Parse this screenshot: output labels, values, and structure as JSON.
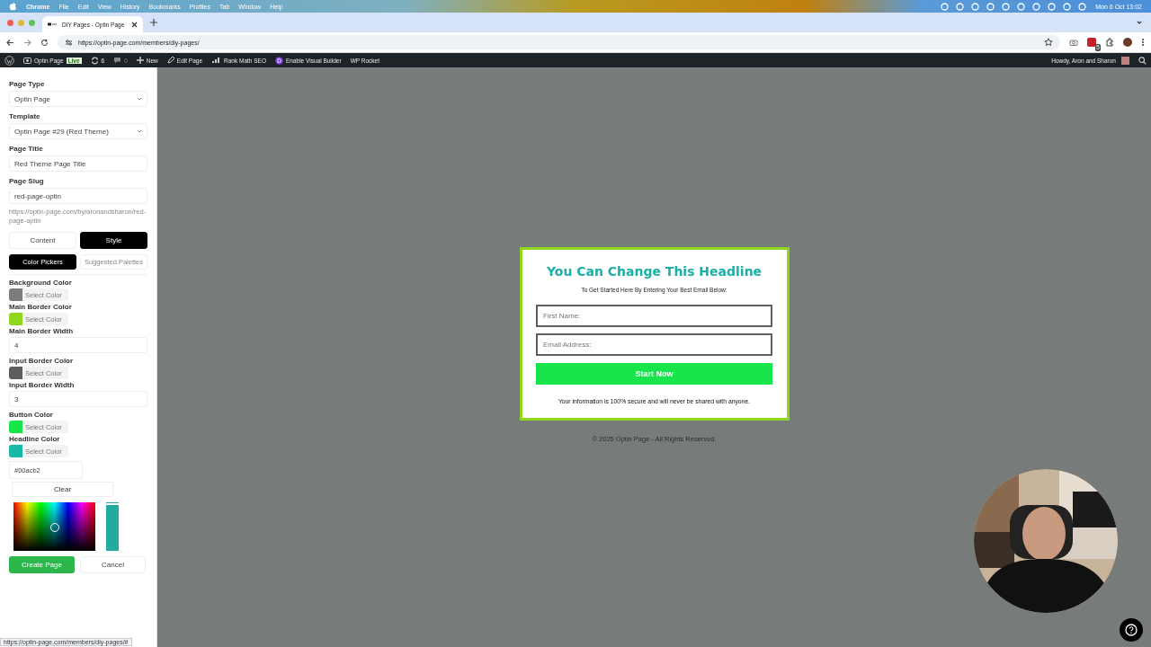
{
  "menubar": {
    "app": "Chrome",
    "menus": [
      "File",
      "Edit",
      "View",
      "History",
      "Bookmarks",
      "Profiles",
      "Tab",
      "Window",
      "Help"
    ],
    "clock": "Mon 6 Oct  13:02"
  },
  "browser": {
    "tab_title": "DIY Pages - Optin Page",
    "url": "https://optin-page.com/members/diy-pages/",
    "extension_badge": "5"
  },
  "admin_bar": {
    "items": [
      {
        "kind": "site",
        "label": "Optin Page",
        "badge": "Live"
      },
      {
        "kind": "updates",
        "label": "6"
      },
      {
        "kind": "comments",
        "label": "0"
      },
      {
        "kind": "new",
        "label": "New"
      },
      {
        "kind": "edit",
        "label": "Edit Page"
      },
      {
        "kind": "seo",
        "label": "Rank Math SEO"
      },
      {
        "kind": "builder",
        "label": "Enable Visual Builder"
      },
      {
        "kind": "plain",
        "label": "WP Rocket"
      }
    ],
    "greeting": "Howdy, Aron and Sharon"
  },
  "sidebar": {
    "fields": [
      {
        "kind": "select",
        "label": "Page Type",
        "value": "Optin Page"
      },
      {
        "kind": "select",
        "label": "Template",
        "value": "Optin Page #29 (Red Theme)"
      },
      {
        "kind": "text",
        "label": "Page Title",
        "value": "Red Theme Page Title"
      },
      {
        "kind": "text",
        "label": "Page Slug",
        "value": "red-page-optin"
      }
    ],
    "slug_url": "https://optin-page.com/by/aronandsharon/red-page-optin",
    "mode_tabs": [
      {
        "label": "Content",
        "selected": false
      },
      {
        "label": "Style",
        "selected": true
      }
    ],
    "picker_tabs": [
      {
        "label": "Color Pickers",
        "selected": true
      },
      {
        "label": "Suggested Palettes",
        "selected": false
      }
    ],
    "settings": [
      {
        "kind": "color",
        "label": "Background Color",
        "color": "#7a7d7c",
        "button": "Select Color"
      },
      {
        "kind": "color",
        "label": "Main Border Color",
        "color": "#8fd61c",
        "button": "Select Color"
      },
      {
        "kind": "number",
        "label": "Main Border Width",
        "value": "4"
      },
      {
        "kind": "color",
        "label": "Input Border Color",
        "color": "#5e5e5e",
        "button": "Select Color"
      },
      {
        "kind": "number",
        "label": "Input Border Width",
        "value": "3"
      },
      {
        "kind": "color",
        "label": "Button Color",
        "color": "#17e54a",
        "button": "Select Color"
      },
      {
        "kind": "color",
        "label": "Headline Color",
        "color": "#1ab8a8",
        "button": "Select Color"
      }
    ],
    "hex_value": "#00acb2",
    "hue_slider": {
      "level": 0.95
    },
    "clear": "Clear",
    "create": "Create Page",
    "cancel": "Cancel"
  },
  "preview": {
    "headline": "You Can Change This Headline",
    "subheadline": "To Get Started Here By Entering Your Best Email Below:",
    "inputs": [
      {
        "placeholder": "First Name:"
      },
      {
        "placeholder": "Email Address:"
      }
    ],
    "button": "Start Now",
    "note": "Your information is 100% secure and will never be shared with anyone.",
    "footer": "© 2025 Optin Page - All Rights Reserved."
  },
  "status_url": "https://optin-page.com/members/diy-pages/#"
}
